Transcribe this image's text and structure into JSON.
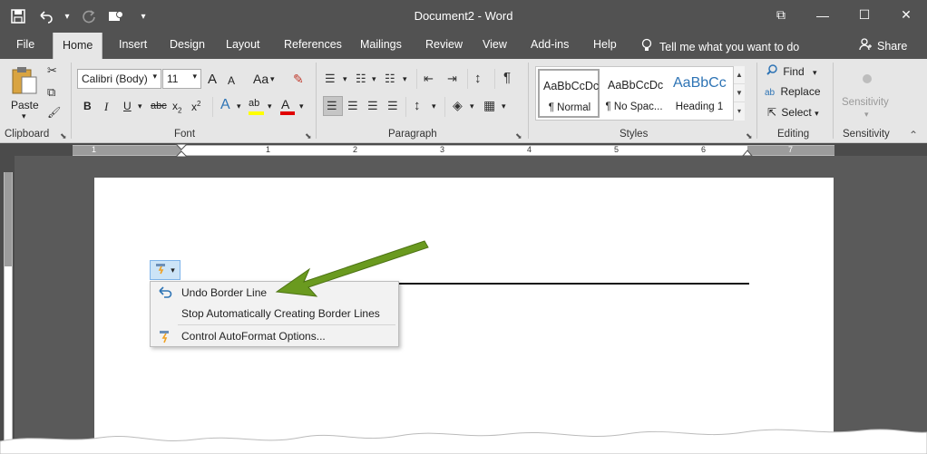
{
  "window": {
    "title": "Document2 - Word",
    "buttons": {
      "restore_ribbon": "⧉",
      "minimize": "—",
      "maximize": "☐",
      "close": "✕"
    }
  },
  "quick_access": {
    "save": "💾",
    "undo": "↶",
    "undo_menu": "▾",
    "redo": "↻",
    "touch": "☝",
    "customize": "▾"
  },
  "tabs": [
    "File",
    "Home",
    "Insert",
    "Design",
    "Layout",
    "References",
    "Mailings",
    "Review",
    "View",
    "Add-ins",
    "Help"
  ],
  "active_tab": "Home",
  "tell_me": {
    "text": "Tell me what you want to do",
    "icon": "💡"
  },
  "share": {
    "label": "Share",
    "icon": "👤"
  },
  "ribbon": {
    "clipboard": {
      "label": "Clipboard",
      "paste": "Paste",
      "paste_menu": "▾",
      "cut": "✂",
      "copy": "⧉",
      "format_painter": "🖌",
      "launcher": "⬊"
    },
    "font": {
      "label": "Font",
      "font_name": "Calibri (Body)",
      "font_size": "11",
      "grow": "A",
      "shrink": "A",
      "case": "Aa",
      "clear": "✎",
      "bold": "B",
      "italic": "I",
      "underline": "U",
      "strikethrough": "abc",
      "subscript": "x",
      "subscript_mark": "2",
      "superscript": "x",
      "superscript_mark": "2",
      "text_effects": "A",
      "highlight": "ab",
      "font_color": "A",
      "highlight_color": "#ffff00",
      "font_color_value": "#e00000",
      "launcher": "⬊",
      "dropdown": "▾"
    },
    "paragraph": {
      "label": "Paragraph",
      "bullets": "☰",
      "numbering": "☷",
      "multilevel": "☷",
      "decrease_indent": "⇤",
      "increase_indent": "⇥",
      "sort": "↕",
      "show_marks": "¶",
      "align_left": "☰",
      "center": "☰",
      "align_right": "☰",
      "justify": "☰",
      "line_spacing": "↕",
      "shading": "◈",
      "borders": "▦",
      "launcher": "⬊",
      "dropdown": "▾"
    },
    "styles": {
      "label": "Styles",
      "items": [
        {
          "sample": "AaBbCcDc",
          "name": "¶ Normal"
        },
        {
          "sample": "AaBbCcDc",
          "name": "¶ No Spac..."
        },
        {
          "sample": "AaBbCc",
          "name": "Heading 1"
        }
      ],
      "heading_color": "#2e74b5",
      "scroll_up": "▲",
      "scroll_down": "▼",
      "more": "▾",
      "launcher": "⬊"
    },
    "editing": {
      "label": "Editing",
      "find": "Find",
      "find_icon": "🔍",
      "replace": "Replace",
      "replace_icon": "ab",
      "select": "Select",
      "select_icon": "⇱",
      "dropdown": "▾"
    },
    "sensitivity": {
      "label": "Sensitivity",
      "button": "Sensitivity",
      "dropdown": "▾",
      "collapse": "⌃"
    }
  },
  "ruler": {
    "numbers": [
      "1",
      "1",
      "2",
      "3",
      "4",
      "5",
      "6",
      "7"
    ]
  },
  "autoformat": {
    "button_icon": "⚡",
    "button_dropdown": "▾",
    "menu": [
      {
        "label": "Undo Border Line",
        "icon": "undo-icon"
      },
      {
        "label": "Stop Automatically Creating Border Lines",
        "icon": ""
      },
      {
        "label": "Control AutoFormat Options...",
        "icon": "autoformat-icon"
      }
    ]
  },
  "arrow_color": "#6a9a1f"
}
